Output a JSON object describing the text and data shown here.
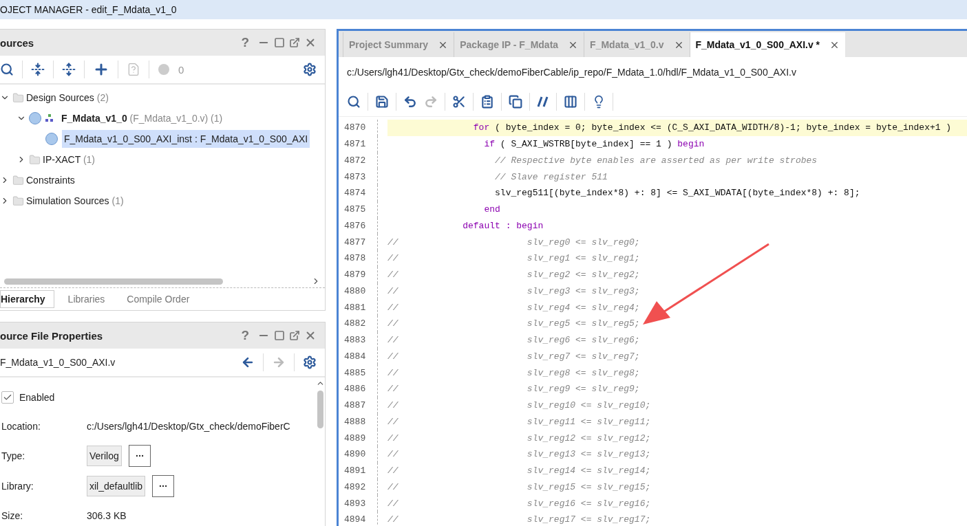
{
  "title_bar": {
    "title": "OJECT MANAGER - edit_F_Mdata_v1_0"
  },
  "sources_panel": {
    "title": "ources",
    "help": "?",
    "issue_count": "0",
    "tree": [
      {
        "label": "Design Sources",
        "note": "(2)",
        "kind": "folder",
        "bold": false,
        "expanded": true,
        "selected": false,
        "children": [
          {
            "label": "F_Mdata_v1_0",
            "note": "(F_Mdata_v1_0.v) (1)",
            "kind": "module",
            "bold": true,
            "expanded": true,
            "selected": false,
            "children": [
              {
                "label": "F_Mdata_v1_0_S00_AXI_inst : F_Mdata_v1_0_S00_AXI",
                "kind": "instance",
                "bold": false,
                "selected": true
              }
            ]
          },
          {
            "label": "IP-XACT",
            "note": "(1)",
            "kind": "folder",
            "bold": false,
            "expanded": false,
            "selected": false
          }
        ]
      },
      {
        "label": "Constraints",
        "kind": "folder",
        "bold": false,
        "expanded": false,
        "selected": false
      },
      {
        "label": "Simulation Sources",
        "note": "(1)",
        "kind": "folder",
        "bold": false,
        "expanded": false,
        "selected": false
      }
    ],
    "tabs": [
      {
        "label": "Hierarchy",
        "selected": true
      },
      {
        "label": "Libraries",
        "selected": false
      },
      {
        "label": "Compile Order",
        "selected": false
      }
    ]
  },
  "properties_panel": {
    "title": "ource File Properties",
    "help": "?",
    "file": "F_Mdata_v1_0_S00_AXI.v",
    "enabled": {
      "label": "Enabled",
      "checked": true
    },
    "rows": [
      {
        "kind": "text",
        "label": "Location:",
        "value": "c:/Users/lgh41/Desktop/Gtx_check/demoFiberC"
      },
      {
        "kind": "box",
        "label": "Type:",
        "value": "Verilog"
      },
      {
        "kind": "box",
        "label": "Library:",
        "value": "xil_defaultlib"
      },
      {
        "kind": "text",
        "label": "Size:",
        "value": "306.3 KB"
      }
    ]
  },
  "editor": {
    "tabs": [
      {
        "label": "Project Summary",
        "selected": false
      },
      {
        "label": "Package IP - F_Mdata",
        "selected": false
      },
      {
        "label": "F_Mdata_v1_0.v",
        "selected": false
      },
      {
        "label": "F_Mdata_v1_0_S00_AXI.v *",
        "selected": true
      }
    ],
    "path": "c:/Users/lgh41/Desktop/Gtx_check/demoFiberCable/ip_repo/F_Mdata_1.0/hdl/F_Mdata_v1_0_S00_AXI.v",
    "lines": [
      {
        "number": "4870",
        "current": true,
        "tokens": [
          {
            "kind": "keyword",
            "text": "                for"
          },
          {
            "kind": "plain",
            "text": " ( byte_index = 0; byte_index <= (C_S_AXI_DATA_WIDTH/8)-1; byte_index = byte_index+1 )"
          }
        ]
      },
      {
        "number": "4871",
        "current": false,
        "tokens": [
          {
            "kind": "keyword",
            "text": "                  if"
          },
          {
            "kind": "plain",
            "text": " ( S_AXI_WSTRB[byte_index] == 1 ) "
          },
          {
            "kind": "keyword",
            "text": "begin"
          }
        ]
      },
      {
        "number": "4872",
        "current": false,
        "tokens": [
          {
            "kind": "comment",
            "text": "                    // Respective byte enables are asserted as per write strobes"
          }
        ]
      },
      {
        "number": "4873",
        "current": false,
        "tokens": [
          {
            "kind": "comment",
            "text": "                    // Slave register 511"
          }
        ]
      },
      {
        "number": "4874",
        "current": false,
        "tokens": [
          {
            "kind": "plain",
            "text": "                    slv_reg511[(byte_index*8) +: 8] <= S_AXI_WDATA[(byte_index*8) +: 8];"
          }
        ]
      },
      {
        "number": "4875",
        "current": false,
        "tokens": [
          {
            "kind": "keyword",
            "text": "                  end"
          }
        ]
      },
      {
        "number": "4876",
        "current": false,
        "tokens": [
          {
            "kind": "keyword",
            "text": "              default : begin"
          }
        ]
      },
      {
        "number": "4877",
        "current": false,
        "tokens": [
          {
            "kind": "comment",
            "text": "//                        slv_reg0 <= slv_reg0;"
          }
        ]
      },
      {
        "number": "4878",
        "current": false,
        "tokens": [
          {
            "kind": "comment",
            "text": "//                        slv_reg1 <= slv_reg1;"
          }
        ]
      },
      {
        "number": "4879",
        "current": false,
        "tokens": [
          {
            "kind": "comment",
            "text": "//                        slv_reg2 <= slv_reg2;"
          }
        ]
      },
      {
        "number": "4880",
        "current": false,
        "tokens": [
          {
            "kind": "comment",
            "text": "//                        slv_reg3 <= slv_reg3;"
          }
        ]
      },
      {
        "number": "4881",
        "current": false,
        "tokens": [
          {
            "kind": "comment",
            "text": "//                        slv_reg4 <= slv_reg4;"
          }
        ]
      },
      {
        "number": "4882",
        "current": false,
        "tokens": [
          {
            "kind": "comment",
            "text": "//                        slv_reg5 <= slv_reg5;"
          }
        ]
      },
      {
        "number": "4883",
        "current": false,
        "tokens": [
          {
            "kind": "comment",
            "text": "//                        slv_reg6 <= slv_reg6;"
          }
        ]
      },
      {
        "number": "4884",
        "current": false,
        "tokens": [
          {
            "kind": "comment",
            "text": "//                        slv_reg7 <= slv_reg7;"
          }
        ]
      },
      {
        "number": "4885",
        "current": false,
        "tokens": [
          {
            "kind": "comment",
            "text": "//                        slv_reg8 <= slv_reg8;"
          }
        ]
      },
      {
        "number": "4886",
        "current": false,
        "tokens": [
          {
            "kind": "comment",
            "text": "//                        slv_reg9 <= slv_reg9;"
          }
        ]
      },
      {
        "number": "4887",
        "current": false,
        "tokens": [
          {
            "kind": "comment",
            "text": "//                        slv_reg10 <= slv_reg10;"
          }
        ]
      },
      {
        "number": "4888",
        "current": false,
        "tokens": [
          {
            "kind": "comment",
            "text": "//                        slv_reg11 <= slv_reg11;"
          }
        ]
      },
      {
        "number": "4889",
        "current": false,
        "tokens": [
          {
            "kind": "comment",
            "text": "//                        slv_reg12 <= slv_reg12;"
          }
        ]
      },
      {
        "number": "4890",
        "current": false,
        "tokens": [
          {
            "kind": "comment",
            "text": "//                        slv_reg13 <= slv_reg13;"
          }
        ]
      },
      {
        "number": "4891",
        "current": false,
        "tokens": [
          {
            "kind": "comment",
            "text": "//                        slv_reg14 <= slv_reg14;"
          }
        ]
      },
      {
        "number": "4892",
        "current": false,
        "tokens": [
          {
            "kind": "comment",
            "text": "//                        slv_reg15 <= slv_reg15;"
          }
        ]
      },
      {
        "number": "4893",
        "current": false,
        "tokens": [
          {
            "kind": "comment",
            "text": "//                        slv_reg16 <= slv_reg16;"
          }
        ]
      },
      {
        "number": "4894",
        "current": false,
        "tokens": [
          {
            "kind": "comment",
            "text": "//                        slv_reg17 <= slv_reg17;"
          }
        ]
      }
    ]
  }
}
